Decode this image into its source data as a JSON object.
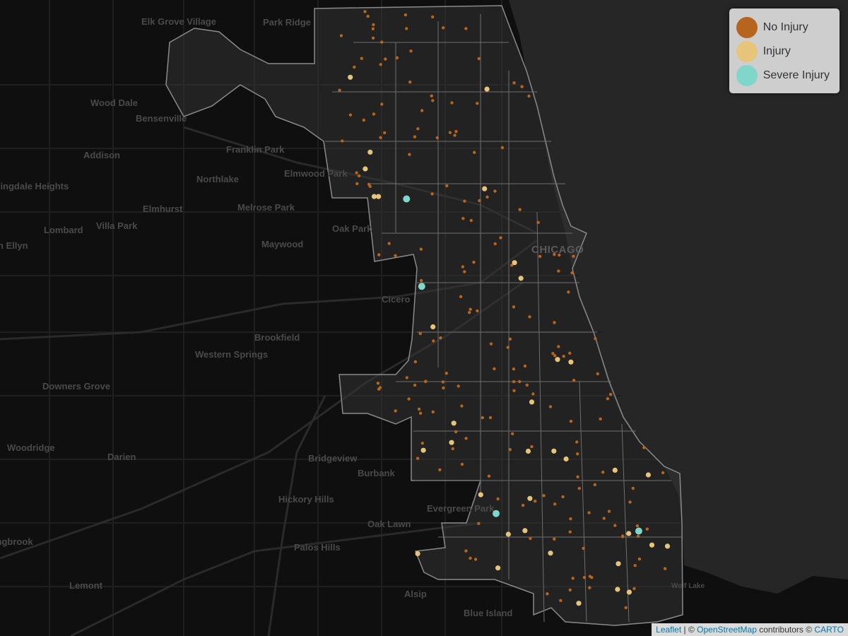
{
  "legend": {
    "items": [
      {
        "label": "No Injury",
        "color": "#b5651d"
      },
      {
        "label": "Injury",
        "color": "#e6c47a"
      },
      {
        "label": "Severe Injury",
        "color": "#7fd6c9"
      }
    ]
  },
  "attribution": {
    "leaflet": "Leaflet",
    "sep1": " | © ",
    "osm": "OpenStreetMap",
    "mid": " contributors © ",
    "carto": "CARTO"
  },
  "places": [
    "Elk Grove Village",
    "Park Ridge",
    "Wood Dale",
    "Bensenville",
    "Addison",
    "Franklin Park",
    "Elmwood Park",
    "Northlake",
    "Bloomingdale Heights",
    "Elmhurst",
    "Melrose Park",
    "Lombard",
    "Villa Park",
    "Oak Park",
    "Glen Ellyn",
    "Maywood",
    "CHICAGO",
    "Cicero",
    "Brookfield",
    "Western Springs",
    "Downers Grove",
    "Woodridge",
    "Darien",
    "Bridgeview",
    "Burbank",
    "Hickory Hills",
    "Evergreen Park",
    "Oak Lawn",
    "Bolingbrook",
    "Palos Hills",
    "Lemont",
    "Alsip",
    "Blue Island",
    "Wolf Lake"
  ]
}
